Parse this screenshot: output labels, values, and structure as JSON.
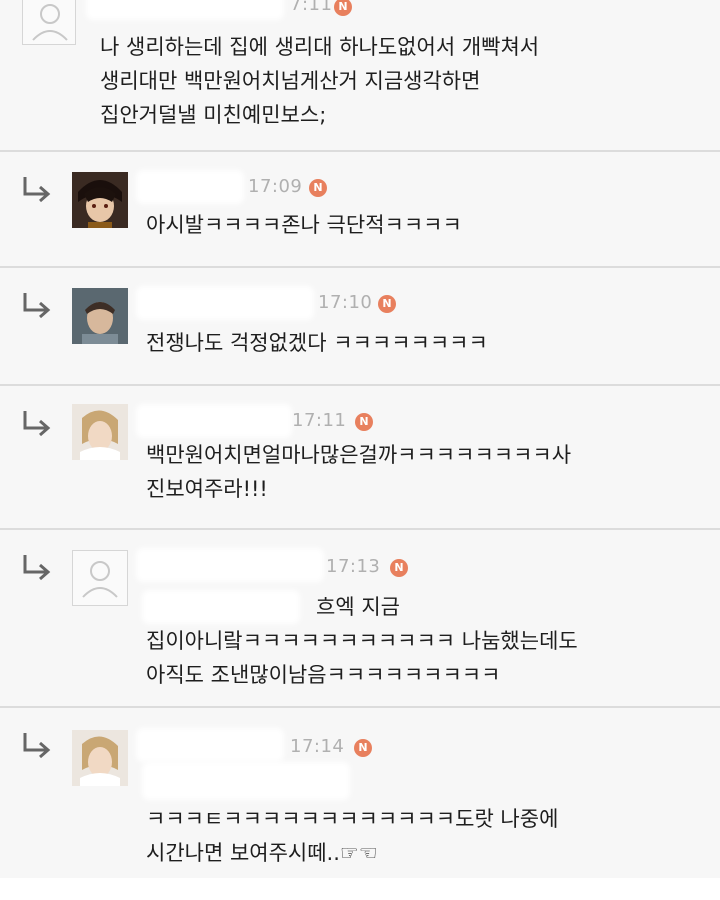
{
  "comments": [
    {
      "time": "7:11",
      "badge": "N",
      "lines": [
        "나 생리하는데 집에 생리대 하나도없어서 개빡쳐서",
        "생리대만 백만원어치넘게산거 지금생각하면",
        "집안거덜낼 미친예민보스;"
      ]
    },
    {
      "time": "17:09",
      "badge": "N",
      "lines": [
        "아시발ㅋㅋㅋㅋ존나 극단적ㅋㅋㅋㅋ"
      ]
    },
    {
      "time": "17:10",
      "badge": "N",
      "lines": [
        "전쟁나도 걱정없겠다 ㅋㅋㅋㅋㅋㅋㅋㅋ"
      ]
    },
    {
      "time": "17:11",
      "badge": "N",
      "lines": [
        "백만원어치면얼마나많은걸까ㅋㅋㅋㅋㅋㅋㅋㅋ사",
        "진보여주라!!!"
      ]
    },
    {
      "time": "17:13",
      "badge": "N",
      "lines": [
        "흐엑 지금",
        "집이아니랔ㅋㅋㅋㅋㅋㅋㅋㅋㅋㅋㅋ 나눔했는데도",
        "아직도 조낸많이남음ㅋㅋㅋㅋㅋㅋㅋㅋㅋ"
      ]
    },
    {
      "time": "17:14",
      "badge": "N",
      "lines": [
        "ㅋㅋㅋㅌㅋㅋㅋㅋㅋㅋㅋㅋㅋㅋㅋㅋ도랏 나중에",
        "시간나면 보여주시떼..☞☜"
      ]
    }
  ]
}
